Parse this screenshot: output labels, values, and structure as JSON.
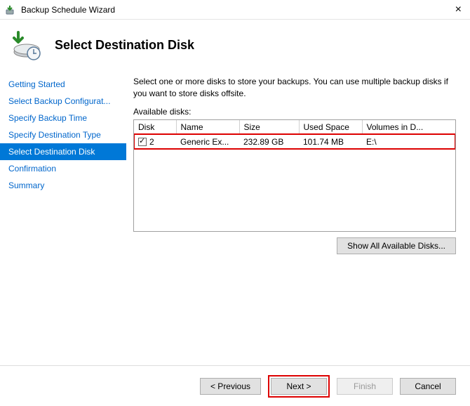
{
  "title": "Backup Schedule Wizard",
  "page_heading": "Select Destination Disk",
  "sidebar": {
    "steps": [
      "Getting Started",
      "Select Backup Configurat...",
      "Specify Backup Time",
      "Specify Destination Type",
      "Select Destination Disk",
      "Confirmation",
      "Summary"
    ],
    "active_index": 4
  },
  "main": {
    "instruction": "Select one or more disks to store your backups. You can use multiple backup disks if you want to store disks offsite.",
    "available_label": "Available disks:",
    "columns": [
      "Disk",
      "Name",
      "Size",
      "Used Space",
      "Volumes in D..."
    ],
    "rows": [
      {
        "checked": true,
        "disk": "2",
        "name": "Generic Ex...",
        "size": "232.89 GB",
        "used": "101.74 MB",
        "volumes": "E:\\"
      }
    ],
    "show_all_label": "Show All Available Disks..."
  },
  "footer": {
    "previous": "< Previous",
    "next": "Next >",
    "finish": "Finish",
    "cancel": "Cancel"
  }
}
